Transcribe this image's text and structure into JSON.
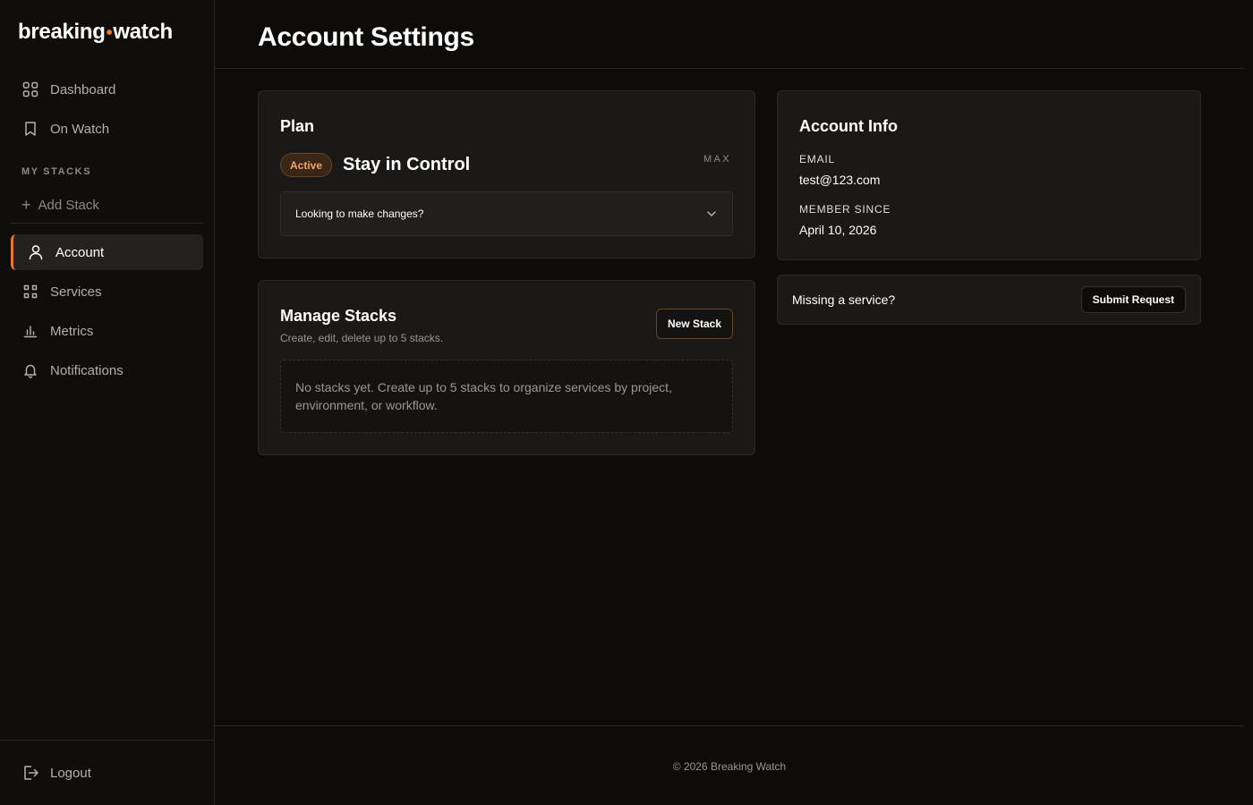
{
  "brand": {
    "part1": "breaking",
    "separator": "•",
    "part2": "watch",
    "accent_color": "#e8762c"
  },
  "sidebar": {
    "nav": [
      {
        "label": "Dashboard",
        "icon": "grid-icon"
      },
      {
        "label": "On Watch",
        "icon": "bookmark-icon"
      }
    ],
    "section_label": "MY STACKS",
    "add_stack_label": "Add Stack",
    "settings_nav": [
      {
        "label": "Account",
        "icon": "user-icon",
        "active": true
      },
      {
        "label": "Services",
        "icon": "apps-icon"
      },
      {
        "label": "Metrics",
        "icon": "bar-chart-icon"
      },
      {
        "label": "Notifications",
        "icon": "bell-icon"
      }
    ],
    "logout_label": "Logout"
  },
  "header": {
    "title": "Account Settings"
  },
  "plan_card": {
    "title": "Plan",
    "status_badge": "Active",
    "plan_name": "Stay in Control",
    "tier": "MAX",
    "changes_prompt": "Looking to make changes?"
  },
  "stacks_card": {
    "title": "Manage Stacks",
    "subtitle": "Create, edit, delete up to 5 stacks.",
    "new_button": "New Stack",
    "empty_message": "No stacks yet. Create up to 5 stacks to organize services by project, environment, or workflow."
  },
  "account_info": {
    "title": "Account Info",
    "email_label": "EMAIL",
    "email_value": "test@123.com",
    "member_label": "MEMBER SINCE",
    "member_value": "April 10, 2026"
  },
  "request_card": {
    "text": "Missing a service?",
    "button": "Submit Request"
  },
  "footer": {
    "copyright": "© 2026 Breaking Watch"
  }
}
